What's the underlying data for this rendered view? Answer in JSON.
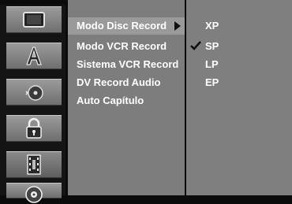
{
  "sidebar": {
    "icons": [
      {
        "name": "tv-icon",
        "selected": false
      },
      {
        "name": "language-icon",
        "selected": false
      },
      {
        "name": "audio-disc-icon",
        "selected": false
      },
      {
        "name": "lock-icon",
        "selected": false
      },
      {
        "name": "film-record-icon",
        "selected": true
      },
      {
        "name": "disc-icon",
        "selected": false
      }
    ]
  },
  "menu": {
    "items": [
      {
        "label": "Modo Disc Record"
      },
      {
        "label": "Modo VCR Record"
      },
      {
        "label": "Sistema VCR Record"
      },
      {
        "label": "DV Record Audio"
      },
      {
        "label": "Auto Capítulo"
      }
    ],
    "selected_index": 0
  },
  "options": {
    "items": [
      {
        "label": "XP"
      },
      {
        "label": "SP"
      },
      {
        "label": "LP"
      },
      {
        "label": "EP"
      }
    ],
    "checked_index": 1
  },
  "colors": {
    "background": "#0b0b0b",
    "menu_panel": "#7d7d7d",
    "option_panel": "#7f7f7f",
    "text": "#ffffff"
  }
}
